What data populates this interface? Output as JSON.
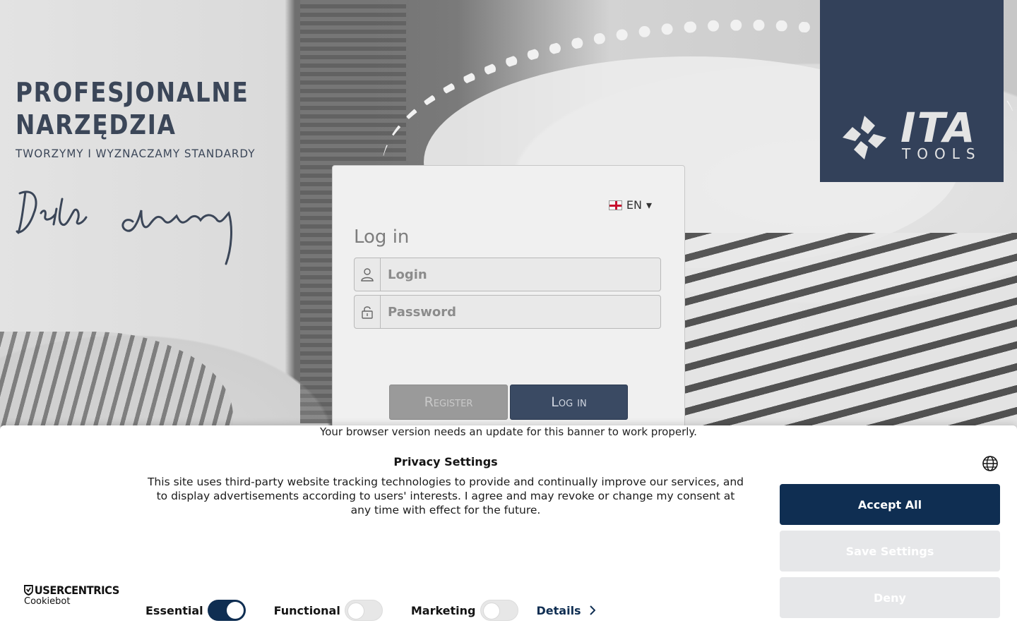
{
  "tagline": {
    "line1": "PROFESJONALNE",
    "line2": "NARZĘDZIA",
    "line3": "TWORZYMY I WYZNACZAMY STANDARDY",
    "signature": "Dzień dobry"
  },
  "logo": {
    "name": "ITA",
    "sub": "TOOLS",
    "bg_color": "#33415a"
  },
  "login": {
    "language": "EN",
    "language_caret": "▾",
    "title": "Log in",
    "login_placeholder": "Login",
    "password_placeholder": "Password",
    "register_label": "Register",
    "login_label": "Log in"
  },
  "cookie": {
    "browser_note": "Your browser version needs an update for this banner to work properly.",
    "title": "Privacy Settings",
    "text": "This site uses third-party website tracking technologies to provide and continually improve our services, and to display advertisements according to users' interests. I agree and may revoke or change my consent at any time with effect for the future.",
    "accept_label": "Accept All",
    "save_label": "Save Settings",
    "deny_label": "Deny",
    "brand": "USERCENTRICS",
    "brand_sub": "Cookiebot",
    "toggles": [
      {
        "label": "Essential",
        "on": true
      },
      {
        "label": "Functional",
        "on": false
      },
      {
        "label": "Marketing",
        "on": false
      }
    ],
    "details_label": "Details",
    "accent": "#0f2e52"
  }
}
